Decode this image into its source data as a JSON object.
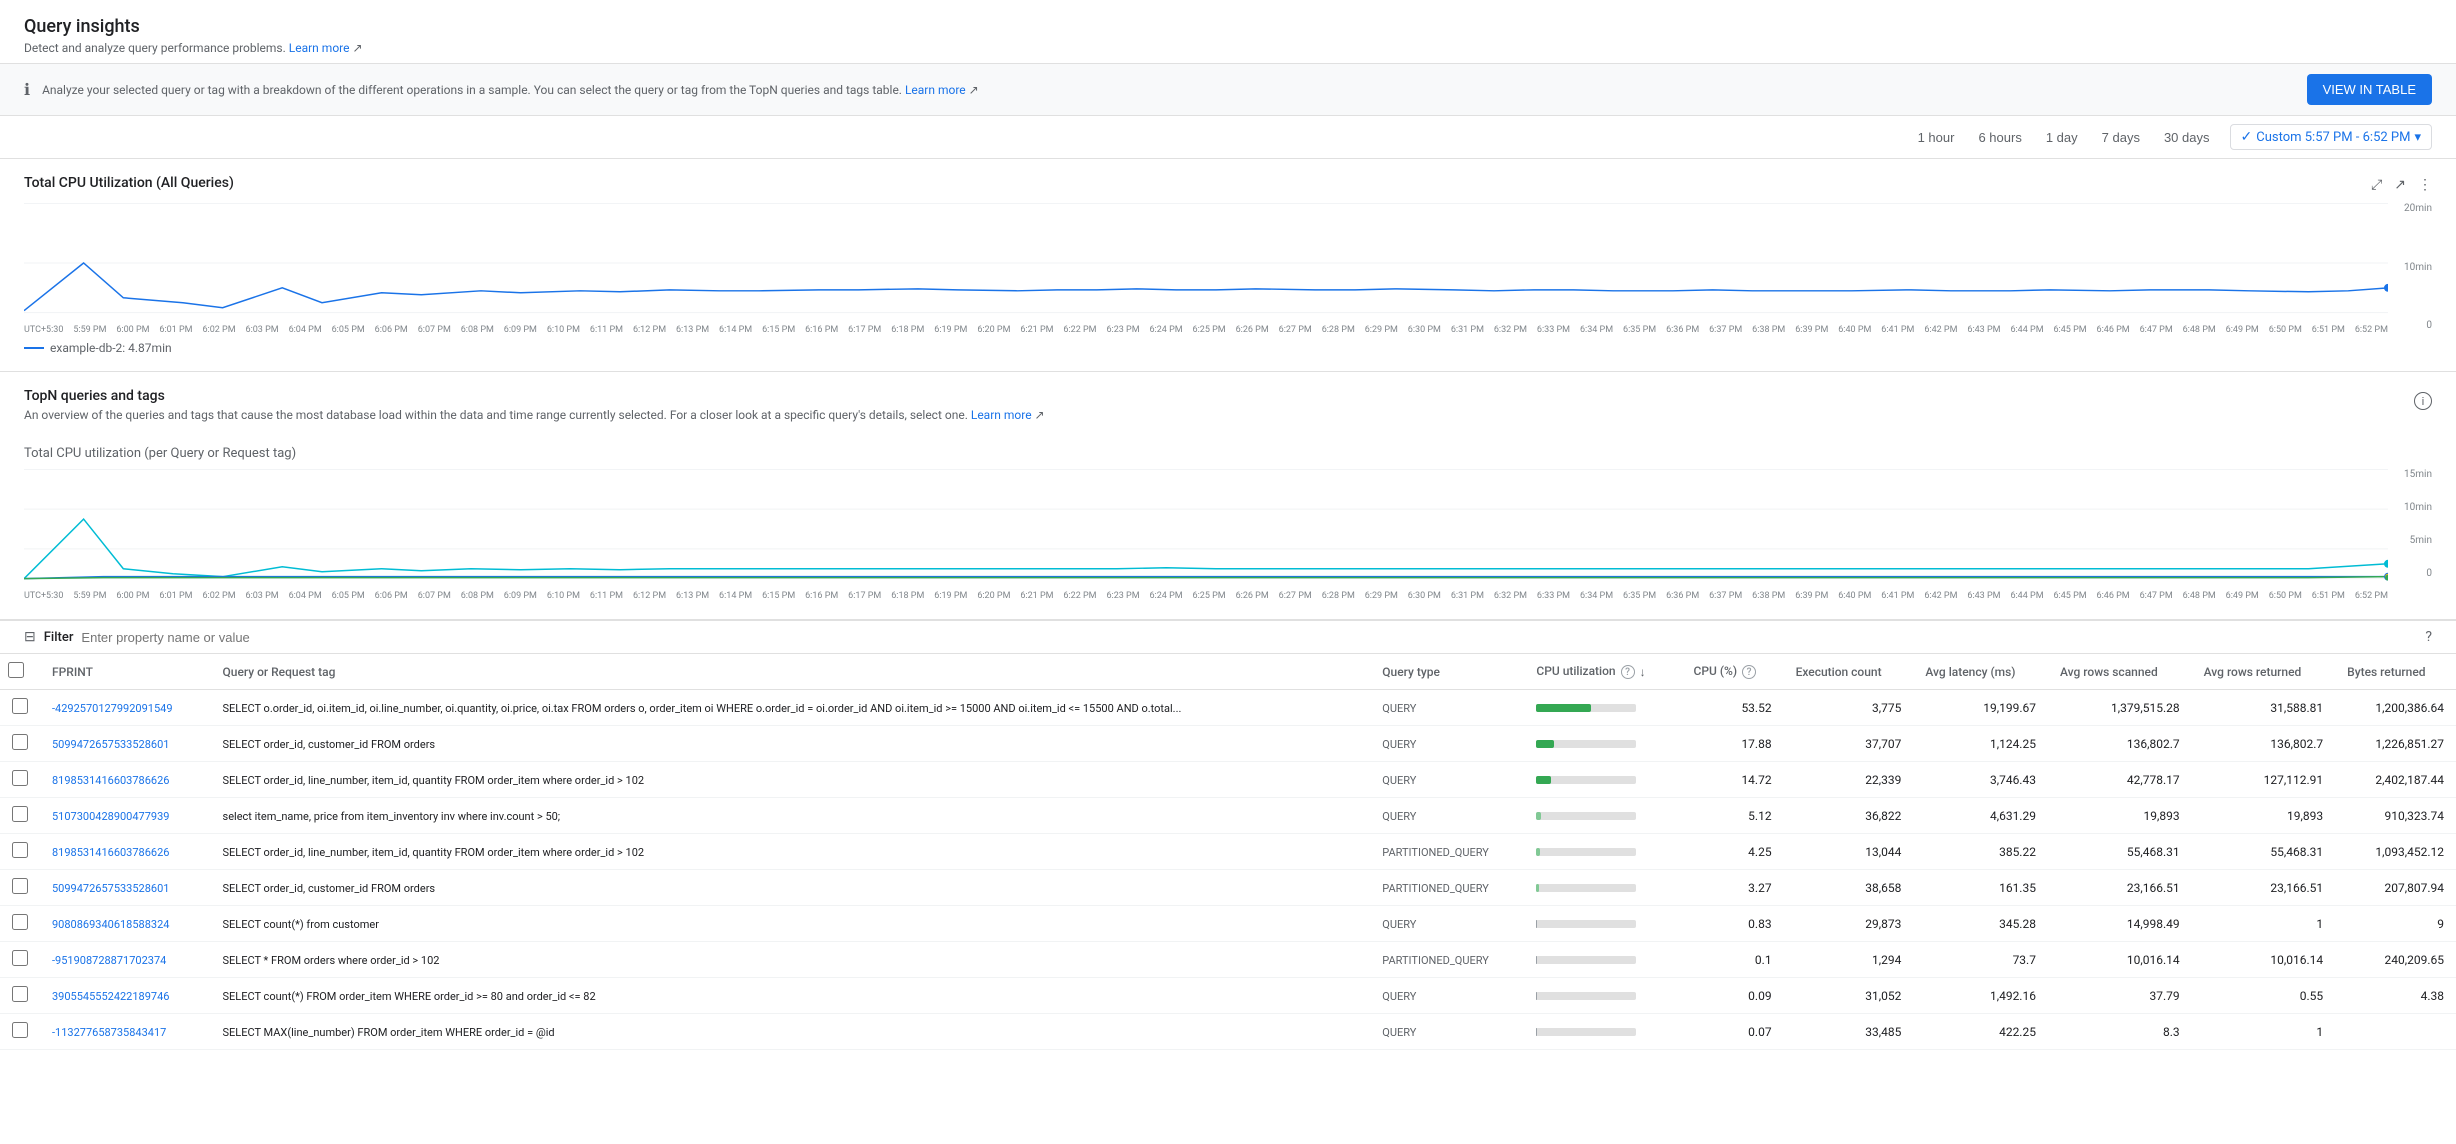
{
  "header": {
    "title": "Query insights",
    "subtitle": "Detect and analyze query performance problems.",
    "learn_more_1": "Learn more",
    "learn_more_url": "#"
  },
  "banner": {
    "text": "Analyze your selected query or tag with a breakdown of the different operations in a sample. You can select the query or tag from the TopN queries and tags table.",
    "learn_more": "Learn more",
    "view_table_btn": "VIEW IN TABLE"
  },
  "time_selector": {
    "buttons": [
      "1 hour",
      "6 hours",
      "1 day",
      "7 days",
      "30 days"
    ],
    "custom_label": "Custom 5:57 PM - 6:52 PM",
    "active": "custom"
  },
  "cpu_chart": {
    "title": "Total CPU Utilization (All Queries)",
    "chart_title": "",
    "y_labels": [
      "20min",
      "10min",
      "0"
    ],
    "legend": "example-db-2: 4.87min"
  },
  "topn": {
    "title": "TopN queries and tags",
    "subtitle": "An overview of the queries and tags that cause the most database load within the data and time range currently selected. For a closer look at a specific query's details, select one.",
    "learn_more": "Learn more",
    "cpu_chart_title": "Total CPU utilization (per Query or Request tag)",
    "y_labels": [
      "15min",
      "10min",
      "5min",
      "0"
    ]
  },
  "filter": {
    "label": "Filter",
    "placeholder": "Enter property name or value"
  },
  "table": {
    "columns": [
      "",
      "FPRINT",
      "Query or Request tag",
      "Query type",
      "CPU utilization",
      "CPU (%)",
      "Execution count",
      "Avg latency (ms)",
      "Avg rows scanned",
      "Avg rows returned",
      "Bytes returned"
    ],
    "rows": [
      {
        "fprint": "-4292570127992091549",
        "query": "SELECT o.order_id, oi.item_id, oi.line_number, oi.quantity, oi.price, oi.tax FROM orders o, order_item oi WHERE o.order_id = oi.order_id AND oi.item_id >= 15000 AND oi.item_id <= 15500 AND o.total...",
        "query_type": "QUERY",
        "cpu_pct": 53.52,
        "cpu_bar_width": 55,
        "cpu_bar_color": "green",
        "execution_count": "3,775",
        "avg_latency": "19,199.67",
        "avg_rows_scanned": "1,379,515.28",
        "avg_rows_returned": "31,588.81",
        "bytes_returned": "1,200,386.64"
      },
      {
        "fprint": "5099472657533528601",
        "query": "SELECT order_id, customer_id FROM orders",
        "query_type": "QUERY",
        "cpu_pct": 17.88,
        "cpu_bar_width": 18,
        "cpu_bar_color": "green",
        "execution_count": "37,707",
        "avg_latency": "1,124.25",
        "avg_rows_scanned": "136,802.7",
        "avg_rows_returned": "136,802.7",
        "bytes_returned": "1,226,851.27"
      },
      {
        "fprint": "8198531416603786626",
        "query": "SELECT order_id, line_number, item_id, quantity FROM order_item where order_id > 102",
        "query_type": "QUERY",
        "cpu_pct": 14.72,
        "cpu_bar_width": 15,
        "cpu_bar_color": "green",
        "execution_count": "22,339",
        "avg_latency": "3,746.43",
        "avg_rows_scanned": "42,778.17",
        "avg_rows_returned": "127,112.91",
        "bytes_returned": "2,402,187.44"
      },
      {
        "fprint": "5107300428900477939",
        "query": "select item_name, price from item_inventory inv where inv.count > 50;",
        "query_type": "QUERY",
        "cpu_pct": 5.12,
        "cpu_bar_width": 5,
        "cpu_bar_color": "light-green",
        "execution_count": "36,822",
        "avg_latency": "4,631.29",
        "avg_rows_scanned": "19,893",
        "avg_rows_returned": "19,893",
        "bytes_returned": "910,323.74"
      },
      {
        "fprint": "8198531416603786626",
        "query": "SELECT order_id, line_number, item_id, quantity FROM order_item where order_id > 102",
        "query_type": "PARTITIONED_QUERY",
        "cpu_pct": 4.25,
        "cpu_bar_width": 4,
        "cpu_bar_color": "light-green",
        "execution_count": "13,044",
        "avg_latency": "385.22",
        "avg_rows_scanned": "55,468.31",
        "avg_rows_returned": "55,468.31",
        "bytes_returned": "1,093,452.12"
      },
      {
        "fprint": "5099472657533528601",
        "query": "SELECT order_id, customer_id FROM orders",
        "query_type": "PARTITIONED_QUERY",
        "cpu_pct": 3.27,
        "cpu_bar_width": 3,
        "cpu_bar_color": "light-green",
        "execution_count": "38,658",
        "avg_latency": "161.35",
        "avg_rows_scanned": "23,166.51",
        "avg_rows_returned": "23,166.51",
        "bytes_returned": "207,807.94"
      },
      {
        "fprint": "9080869340618588324",
        "query": "SELECT count(*) from customer",
        "query_type": "QUERY",
        "cpu_pct": 0.83,
        "cpu_bar_width": 1,
        "cpu_bar_color": "gray",
        "execution_count": "29,873",
        "avg_latency": "345.28",
        "avg_rows_scanned": "14,998.49",
        "avg_rows_returned": "1",
        "bytes_returned": "9"
      },
      {
        "fprint": "-951908728871702374",
        "query": "SELECT * FROM orders where order_id > 102",
        "query_type": "PARTITIONED_QUERY",
        "cpu_pct": 0.1,
        "cpu_bar_width": 1,
        "cpu_bar_color": "gray",
        "execution_count": "1,294",
        "avg_latency": "73.7",
        "avg_rows_scanned": "10,016.14",
        "avg_rows_returned": "10,016.14",
        "bytes_returned": "240,209.65"
      },
      {
        "fprint": "3905545552422189746",
        "query": "SELECT count(*) FROM order_item WHERE order_id >= 80 and order_id <= 82",
        "query_type": "QUERY",
        "cpu_pct": 0.09,
        "cpu_bar_width": 1,
        "cpu_bar_color": "gray",
        "execution_count": "31,052",
        "avg_latency": "1,492.16",
        "avg_rows_scanned": "37.79",
        "avg_rows_returned": "0.55",
        "bytes_returned": "4.38"
      },
      {
        "fprint": "-113277658735843417",
        "query": "SELECT MAX(line_number) FROM order_item WHERE order_id = @id",
        "query_type": "QUERY",
        "cpu_pct": 0.07,
        "cpu_bar_width": 1,
        "cpu_bar_color": "gray",
        "execution_count": "33,485",
        "avg_latency": "422.25",
        "avg_rows_scanned": "8.3",
        "avg_rows_returned": "1",
        "bytes_returned": ""
      }
    ]
  }
}
